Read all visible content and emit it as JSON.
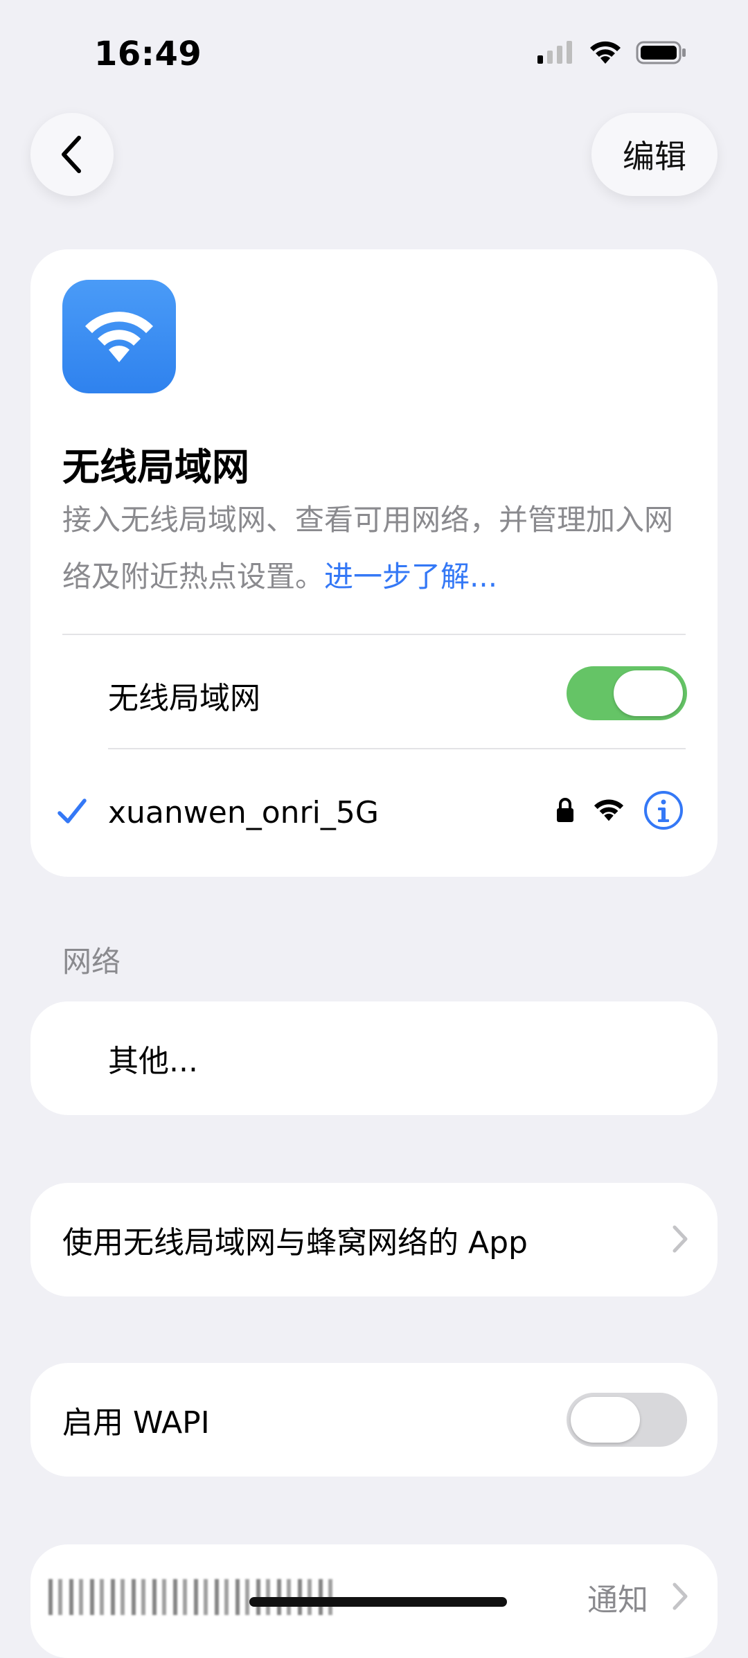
{
  "status_bar": {
    "time": "16:49"
  },
  "nav": {
    "edit_label": "编辑"
  },
  "hero": {
    "icon": "wifi-icon",
    "title": "无线局域网",
    "description": "接入无线局域网、查看可用网络，并管理加入网络及附近热点设置。",
    "learn_more": "进一步了解..."
  },
  "wifi_toggle": {
    "label": "无线局域网",
    "state": "on"
  },
  "current_network": {
    "name": "xuanwen_onri_5G",
    "icons": [
      "checkmark-icon",
      "lock-icon",
      "wifi-signal-icon",
      "info-icon"
    ]
  },
  "networks_section": {
    "header": "网络",
    "other_label": "其他..."
  },
  "apps_row": {
    "label": "使用无线局域网与蜂窝网络的 App"
  },
  "wapi_row": {
    "label": "启用 WAPI",
    "state": "off"
  },
  "notify_row": {
    "label": "通知"
  },
  "colors": {
    "accent": "#3478F6",
    "toggle_on": "#65C466",
    "toggle_off": "#D8D8DB",
    "background": "#F0F0F5"
  }
}
